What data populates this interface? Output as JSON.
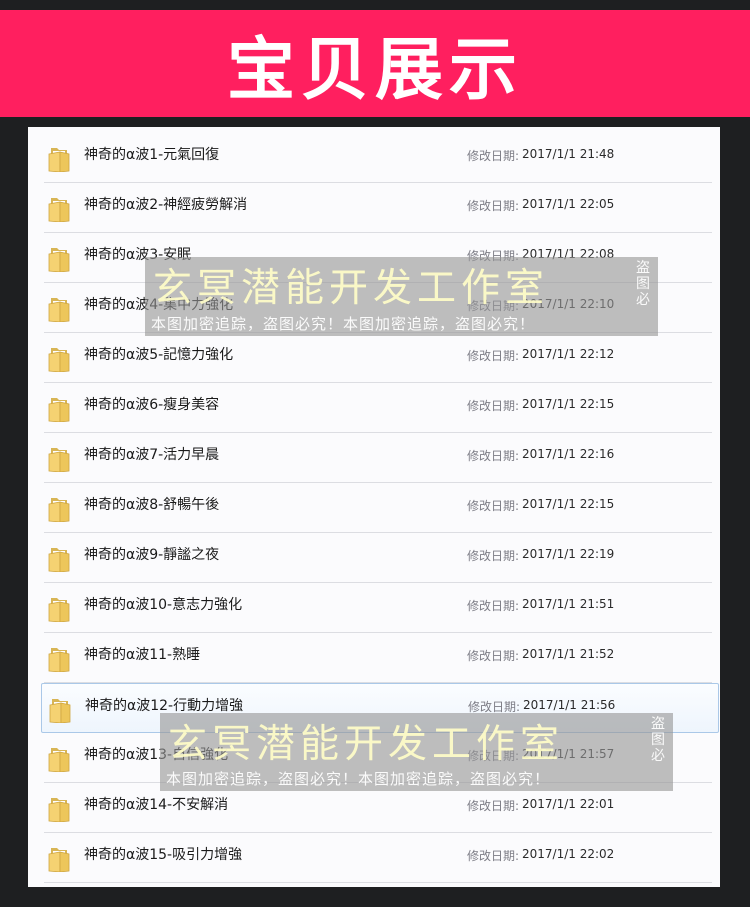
{
  "banner": {
    "title": "宝贝展示",
    "color": "#ff1f5f"
  },
  "files": [
    {
      "name": "神奇的α波1-元氣回復",
      "date_label": "修改日期:",
      "date": "2017/1/1 21:48",
      "icon": "folder-icon"
    },
    {
      "name": "神奇的α波2-神經疲勞解消",
      "date_label": "修改日期:",
      "date": "2017/1/1 22:05",
      "icon": "folder-icon"
    },
    {
      "name": "神奇的α波3-安眠",
      "date_label": "修改日期:",
      "date": "2017/1/1 22:08",
      "icon": "folder-icon"
    },
    {
      "name": "神奇的α波4-集中力強化",
      "date_label": "修改日期:",
      "date": "2017/1/1 22:10",
      "icon": "folder-icon"
    },
    {
      "name": "神奇的α波5-記憶力強化",
      "date_label": "修改日期:",
      "date": "2017/1/1 22:12",
      "icon": "folder-icon"
    },
    {
      "name": "神奇的α波6-瘦身美容",
      "date_label": "修改日期:",
      "date": "2017/1/1 22:15",
      "icon": "folder-icon"
    },
    {
      "name": "神奇的α波7-活力早晨",
      "date_label": "修改日期:",
      "date": "2017/1/1 22:16",
      "icon": "folder-icon"
    },
    {
      "name": "神奇的α波8-舒暢午後",
      "date_label": "修改日期:",
      "date": "2017/1/1 22:15",
      "icon": "folder-icon"
    },
    {
      "name": "神奇的α波9-靜謐之夜",
      "date_label": "修改日期:",
      "date": "2017/1/1 22:19",
      "icon": "folder-icon"
    },
    {
      "name": "神奇的α波10-意志力強化",
      "date_label": "修改日期:",
      "date": "2017/1/1 21:51",
      "icon": "folder-icon"
    },
    {
      "name": "神奇的α波11-熟睡",
      "date_label": "修改日期:",
      "date": "2017/1/1 21:52",
      "icon": "folder-icon"
    },
    {
      "name": "神奇的α波12-行動力增強",
      "date_label": "修改日期:",
      "date": "2017/1/1 21:56",
      "icon": "folder-icon",
      "selected": true
    },
    {
      "name": "神奇的α波13-自信強化",
      "date_label": "修改日期:",
      "date": "2017/1/1 21:57",
      "icon": "folder-icon"
    },
    {
      "name": "神奇的α波14-不安解消",
      "date_label": "修改日期:",
      "date": "2017/1/1 22:01",
      "icon": "folder-icon"
    },
    {
      "name": "神奇的α波15-吸引力增強",
      "date_label": "修改日期:",
      "date": "2017/1/1 22:02",
      "icon": "folder-icon"
    }
  ],
  "watermark": {
    "main": "玄冥潜能开发工作室",
    "side": "盗图必",
    "sub": "本图加密追踪，盗图必究！本图加密追踪，盗图必究！"
  }
}
